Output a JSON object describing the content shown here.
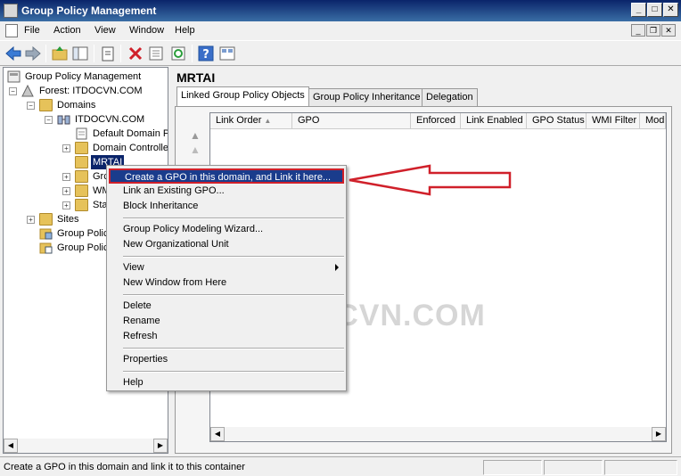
{
  "window": {
    "title": "Group Policy Management"
  },
  "menubar": {
    "items": [
      "File",
      "Action",
      "View",
      "Window",
      "Help"
    ]
  },
  "tree": {
    "root": "Group Policy Management",
    "forest": "Forest: ITDOCVN.COM",
    "domains": "Domains",
    "domain": "ITDOCVN.COM",
    "default_policy": "Default Domain Po",
    "domain_controllers": "Domain Controller",
    "selected_ou": "MRTAI",
    "group_partial": "Grc",
    "wmi_partial": "WM",
    "starter_partial": "Sta",
    "sites": "Sites",
    "modeling_partial": "Group Polic",
    "results_partial": "Group Polic"
  },
  "right_pane": {
    "title": "MRTAI",
    "tabs": [
      "Linked Group Policy Objects",
      "Group Policy Inheritance",
      "Delegation"
    ],
    "columns": [
      "Link Order",
      "GPO",
      "Enforced",
      "Link Enabled",
      "GPO Status",
      "WMI Filter",
      "Mod"
    ]
  },
  "context_menu": {
    "items": [
      "Create a GPO in this domain, and Link it here...",
      "Link an Existing GPO...",
      "Block Inheritance",
      "Group Policy Modeling Wizard...",
      "New Organizational Unit",
      "View",
      "New Window from Here",
      "Delete",
      "Rename",
      "Refresh",
      "Properties",
      "Help"
    ]
  },
  "watermark": "ITDOCVN.COM",
  "statusbar": {
    "text": "Create a GPO in this domain and link it to this container"
  },
  "colors": {
    "highlight": "#1a3c8c",
    "annotation_red": "#d0202a"
  }
}
